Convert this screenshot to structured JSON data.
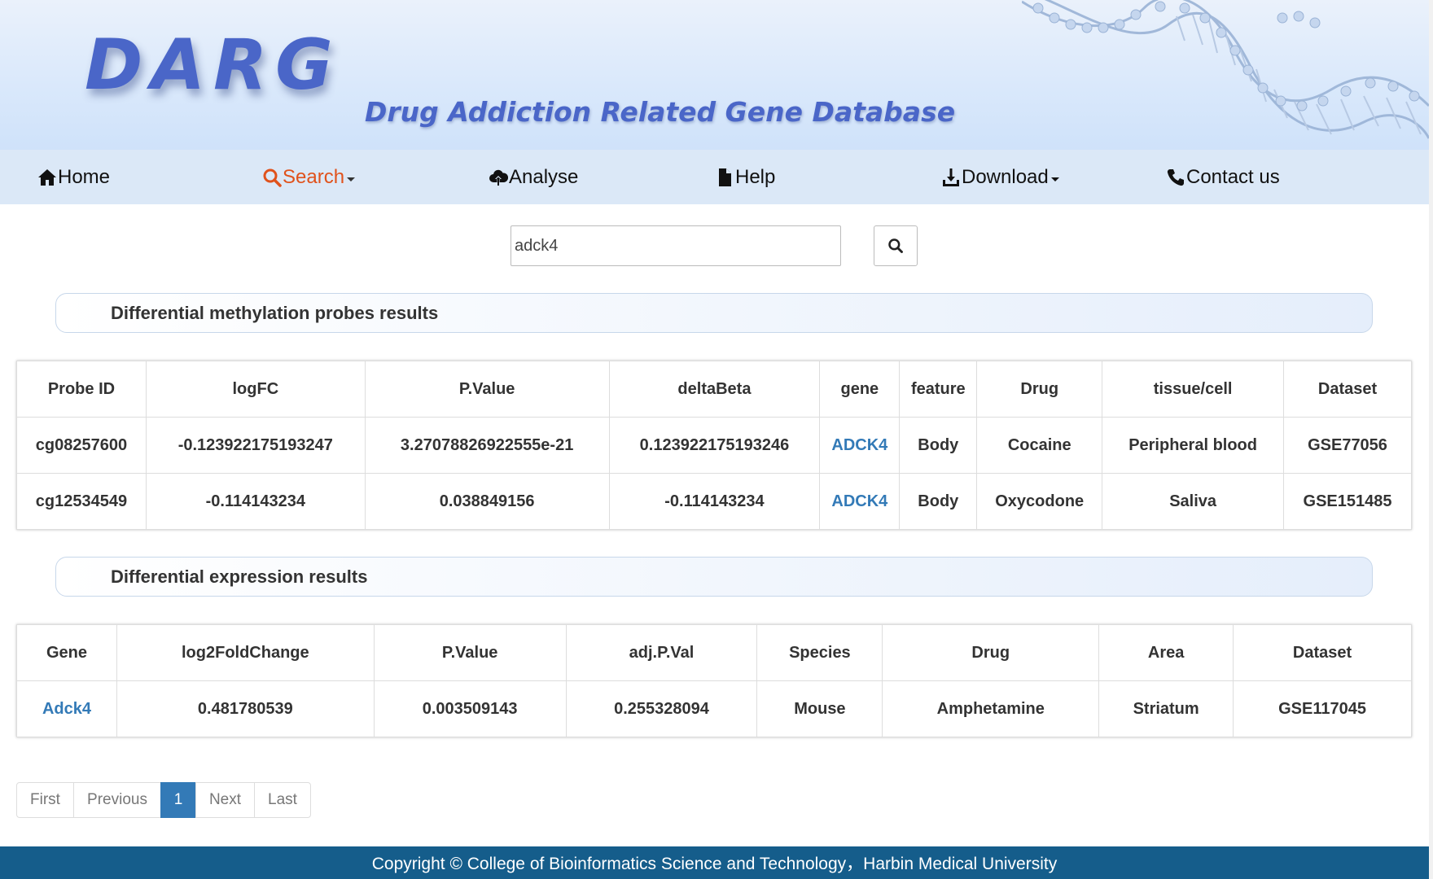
{
  "header": {
    "logo": "DARG",
    "tagline": "Drug Addiction Related Gene Database"
  },
  "nav": [
    {
      "label": "Home",
      "icon": "home-icon"
    },
    {
      "label": "Search",
      "icon": "search-icon",
      "dropdown": true,
      "active": true
    },
    {
      "label": "Analyse",
      "icon": "cloud-upload-icon"
    },
    {
      "label": "Help",
      "icon": "file-icon"
    },
    {
      "label": "Download",
      "icon": "download-icon",
      "dropdown": true
    },
    {
      "label": "Contact us",
      "icon": "phone-icon"
    }
  ],
  "search": {
    "value": "adck4",
    "button_icon": "search-icon"
  },
  "methylation": {
    "title": "Differential methylation probes results",
    "columns": [
      "Probe ID",
      "logFC",
      "P.Value",
      "deltaBeta",
      "gene",
      "feature",
      "Drug",
      "tissue/cell",
      "Dataset"
    ],
    "rows": [
      [
        "cg08257600",
        "-0.123922175193247",
        "3.27078826922555e-21",
        "0.123922175193246",
        "ADCK4",
        "Body",
        "Cocaine",
        "Peripheral blood",
        "GSE77056"
      ],
      [
        "cg12534549",
        "-0.114143234",
        "0.038849156",
        "-0.114143234",
        "ADCK4",
        "Body",
        "Oxycodone",
        "Saliva",
        "GSE151485"
      ]
    ]
  },
  "expression": {
    "title": "Differential expression results",
    "columns": [
      "Gene",
      "log2FoldChange",
      "P.Value",
      "adj.P.Val",
      "Species",
      "Drug",
      "Area",
      "Dataset"
    ],
    "rows": [
      [
        "Adck4",
        "0.481780539",
        "0.003509143",
        "0.255328094",
        "Mouse",
        "Amphetamine",
        "Striatum",
        "GSE117045"
      ]
    ]
  },
  "pagination": {
    "first": "First",
    "previous": "Previous",
    "current": "1",
    "next": "Next",
    "last": "Last"
  },
  "footer": {
    "text": "Copyright © College of Bioinformatics Science and Technology，Harbin Medical University"
  },
  "colors": {
    "brand": "#4a66c8",
    "nav_active": "#e0521c",
    "link": "#337ab7",
    "footer_bg": "#155d8b"
  }
}
